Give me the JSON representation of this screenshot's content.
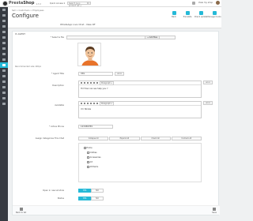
{
  "topbar": {
    "brand_a": "Presta",
    "brand_b": "Shop",
    "version": "1.7.2",
    "quick_access": "Quick Access ▾",
    "search_placeholder": "Search (e.g.: product ref...)",
    "right_label": "View my shop"
  },
  "header": {
    "breadcrumb": "Sell > Customers > Employees",
    "title": "Configure",
    "subtitle": "WhatsApp Live Chat - New RF",
    "toolbar": [
      {
        "label": "Back"
      },
      {
        "label": "Translate"
      },
      {
        "label": "Check update"
      },
      {
        "label": "Manage hooks"
      }
    ]
  },
  "panel": {
    "heading": "⚙ AGENT",
    "fields": {
      "photo_label": "* Select a file",
      "photo_button": "→ Add files",
      "photo_note": "Recommended size 100px",
      "name_label": "* Agent Title",
      "name_value": "URL",
      "lang": "en ▾",
      "desc_label": "Description",
      "desc_value": "Hi! How can we help you ?",
      "desc_format": "Paragraph ▾",
      "avail_label": "Available",
      "avail_value": "I'm Stroke",
      "phone_label": "* Active Phone",
      "phone_value": "123456789",
      "groups_label": "Assign Categories This Chat"
    },
    "groups_bar": [
      "Collapse All",
      "Expand All",
      "Check All",
      "Uncheck All"
    ],
    "tree": [
      {
        "label": "Home",
        "indent": 0
      },
      {
        "label": "Clothes",
        "indent": 1
      },
      {
        "label": "Accessories",
        "indent": 1
      },
      {
        "label": "Art",
        "indent": 1
      },
      {
        "label": "Alt Items",
        "indent": 1
      }
    ],
    "toggles": [
      {
        "label": "Open in new window",
        "on": "YES",
        "off": "NO"
      },
      {
        "label": "Status",
        "on": "YES",
        "off": "NO"
      }
    ],
    "footer_back": "Back to list",
    "footer_save": "Save"
  },
  "sidebar_count": 18,
  "sidebar_active_index": 10,
  "colors": {
    "accent": "#25b9d7",
    "sidebar": "#363a41"
  }
}
